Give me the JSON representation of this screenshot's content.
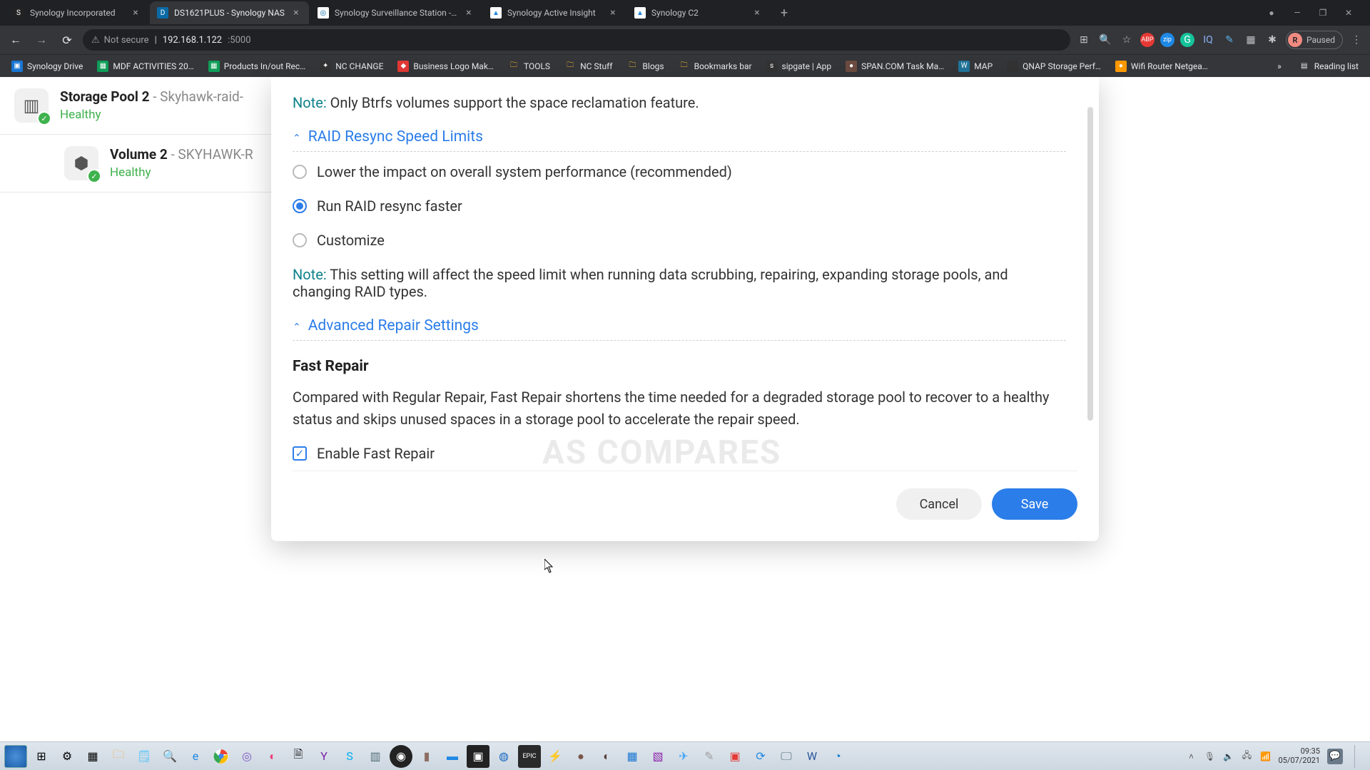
{
  "browser": {
    "tabs": [
      {
        "title": "Synology Incorporated",
        "active": false,
        "favicon_bg": "#222",
        "favicon_fg": "#fff",
        "favicon_text": "S"
      },
      {
        "title": "DS1621PLUS - Synology NAS",
        "active": true,
        "favicon_bg": "#0a6aa6",
        "favicon_fg": "#fff",
        "favicon_text": "D"
      },
      {
        "title": "Synology Surveillance Station - D",
        "active": false,
        "favicon_bg": "#fff",
        "favicon_fg": "#0a6aa6",
        "favicon_text": "◎"
      },
      {
        "title": "Synology Active Insight",
        "active": false,
        "favicon_bg": "#fff",
        "favicon_fg": "#1e88e5",
        "favicon_text": "▲"
      },
      {
        "title": "Synology C2",
        "active": false,
        "favicon_bg": "#fff",
        "favicon_fg": "#1e88e5",
        "favicon_text": "▲"
      }
    ],
    "address": {
      "warn_text": "Not secure",
      "host": "192.168.1.122",
      "port": ":5000"
    },
    "profile": {
      "initial": "R",
      "label": "Paused"
    },
    "bookmarks": [
      {
        "label": "Synology Drive",
        "favicon_bg": "#1976d2",
        "favicon_text": "▣"
      },
      {
        "label": "MDF ACTIVITIES 20…",
        "favicon_bg": "#0f9d58",
        "favicon_text": "▦"
      },
      {
        "label": "Products In/out Rec…",
        "favicon_bg": "#0f9d58",
        "favicon_text": "▦"
      },
      {
        "label": "NC CHANGE",
        "favicon_bg": "#333",
        "favicon_text": "✦"
      },
      {
        "label": "Business Logo Mak…",
        "favicon_bg": "#e53935",
        "favicon_text": "◆"
      },
      {
        "label": "TOOLS",
        "favicon_bg": "#fbc02d",
        "favicon_text": "🗀"
      },
      {
        "label": "NC Stuff",
        "favicon_bg": "#fbc02d",
        "favicon_text": "🗀"
      },
      {
        "label": "Blogs",
        "favicon_bg": "#fbc02d",
        "favicon_text": "🗀"
      },
      {
        "label": "Bookmarks bar",
        "favicon_bg": "#fbc02d",
        "favicon_text": "🗀"
      },
      {
        "label": "sipgate | App",
        "favicon_bg": "#333",
        "favicon_text": "s"
      },
      {
        "label": "SPAN.COM Task Ma…",
        "favicon_bg": "#6d4c41",
        "favicon_text": "●"
      },
      {
        "label": "MAP",
        "favicon_bg": "#21759b",
        "favicon_text": "W"
      },
      {
        "label": "QNAP Storage Perf…",
        "favicon_bg": "#333",
        "favicon_text": " "
      },
      {
        "label": "Wifi Router Netgea…",
        "favicon_bg": "#ff9800",
        "favicon_text": "●"
      }
    ],
    "reading_list_label": "Reading list"
  },
  "sidebar": {
    "pool": {
      "title_bold": "Storage Pool 2",
      "title_sub": " - Skyhawk-raid-",
      "status": "Healthy"
    },
    "volume": {
      "title_bold": "Volume 2",
      "title_sub": " - SKYHAWK-R",
      "status": "Healthy"
    }
  },
  "dialog": {
    "note1_label": "Note:",
    "note1_text": " Only Btrfs volumes support the space reclamation feature.",
    "section1_title": "RAID Resync Speed Limits",
    "radios": {
      "opt1": "Lower the impact on overall system performance (recommended)",
      "opt2": "Run RAID resync faster",
      "opt3": "Customize",
      "selected": "opt2"
    },
    "note2_label": "Note:",
    "note2_text": " This setting will affect the speed limit when running data scrubbing, repairing, expanding storage pools, and changing RAID types.",
    "section2_title": "Advanced Repair Settings",
    "fast_repair_heading": "Fast Repair",
    "fast_repair_body": "Compared with Regular Repair, Fast Repair shortens the time needed for a degraded storage pool to recover to a healthy status and skips unused spaces in a storage pool to accelerate the repair speed.",
    "checkbox_label": "Enable Fast Repair",
    "checkbox_checked": true,
    "cancel_label": "Cancel",
    "save_label": "Save"
  },
  "watermark_text": "AS COMPARES",
  "taskbar": {
    "clock_time": "09:35",
    "clock_date": "05/07/2021"
  }
}
